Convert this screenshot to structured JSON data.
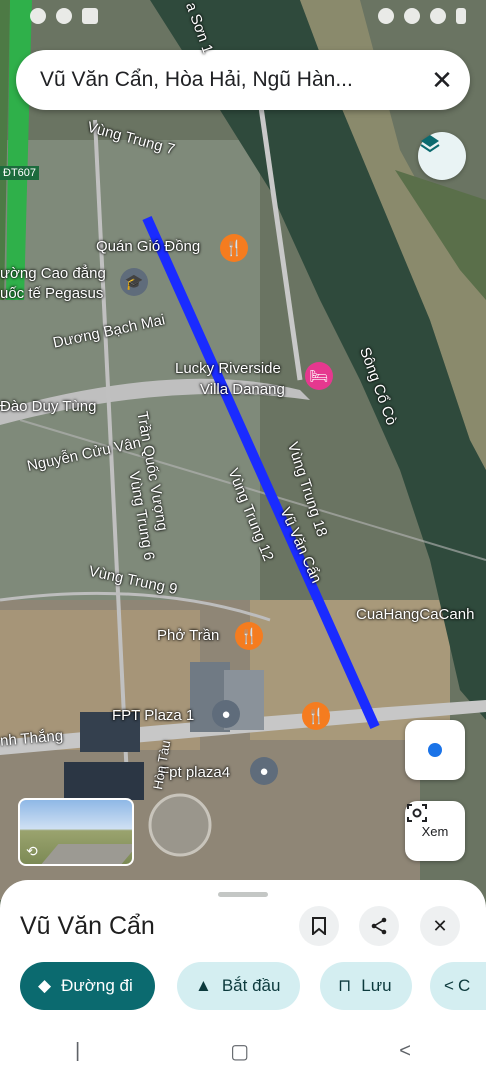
{
  "status_bar": {
    "left_icons": [
      "app-icon",
      "app-icon",
      "zalo-icon"
    ],
    "right_icons": [
      "location-icon",
      "wifi-icon",
      "signal-icon",
      "battery-icon"
    ]
  },
  "search": {
    "query": "Vũ Văn Cẩn, Hòa Hải, Ngũ Hàn..."
  },
  "map": {
    "labels": {
      "son": "a Sơn 1",
      "dt607": "ĐT607",
      "vung_trung_7": "Vùng Trung 7",
      "quan_gio_dong": "Quán Gió Đồng",
      "cao_dang": "ường Cao đẳng",
      "pegasus": "uốc tế Pegasus",
      "bach_mai": "Dương Bạch Mai",
      "lucky1": "Lucky Riverside",
      "lucky2": "Villa Danang",
      "dao_duy_tung": "Đào Duy Tùng",
      "nguyen_cuu_van": "Nguyễn Cửu Vân",
      "tran_quoc_vuong": "Trần Quốc Vượng",
      "vung_trung_6": "Vùng Trung 6",
      "vung_trung_12": "Vùng Trung 12",
      "vung_trung_18": "Vùng Trung 18",
      "vu_van_can": "Vũ Văn Cẩn",
      "song_co_co": "Sông Cổ Cò",
      "vung_trung_9": "Vùng Trung 9",
      "cuahang": "CuaHangCaCanh",
      "pho_tran": "Phở Trần",
      "fpt_plaza1": "FPT Plaza 1",
      "fpt_plaza4": "Fpt plaza4",
      "nh_thang": "nh Thắng",
      "hon_tau": "Hòn Tàu"
    },
    "route_color": "#1a2bff",
    "restaurant_color": "#f57c1f",
    "hotel_color": "#e6388f",
    "school_color": "#5f6c7b"
  },
  "controls": {
    "lens_label": "Xem"
  },
  "sheet": {
    "place_name": "Vũ Văn Cẩn",
    "chips": [
      {
        "label": "Đường đi",
        "icon": "directions-icon"
      },
      {
        "label": "Bắt đầu",
        "icon": "navigation-arrow-icon"
      },
      {
        "label": "Lưu",
        "icon": "bookmark-icon"
      },
      {
        "label": "C",
        "icon": "share-icon"
      }
    ]
  }
}
